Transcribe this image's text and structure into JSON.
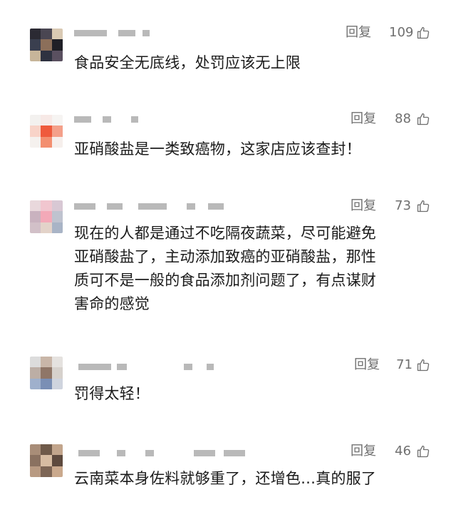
{
  "comments": [
    {
      "reply_label": "回复",
      "likes": "109",
      "text": "食品安全无底线，处罚应该无上限",
      "avatar_colors": [
        "#2b2a33",
        "#4a4652",
        "#d9c9b3",
        "#3a3f4f",
        "#8c6f5a",
        "#1f1f26",
        "#c7b59a",
        "#2e3240",
        "#5a5060"
      ]
    },
    {
      "reply_label": "回复",
      "likes": "88",
      "text": "亚硝酸盐是一类致癌物，这家店应该查封！",
      "avatar_colors": [
        "#f3f1ef",
        "#f7e9e6",
        "#f6f4f2",
        "#f8d3c8",
        "#ef5a3c",
        "#f4a08a",
        "#f5f1ee",
        "#f38f70",
        "#f6efec"
      ]
    },
    {
      "reply_label": "回复",
      "likes": "73",
      "text": "现在的人都是通过不吃隔夜蔬菜，尽可能避免\n亚硝酸盐了，主动添加致癌的亚硝酸盐，那性\n质可不是一般的食品添加剂问题了，有点谋财\n害命的感觉",
      "avatar_colors": [
        "#e9d8dc",
        "#f1c6cf",
        "#d8c8d4",
        "#c9b2bf",
        "#f3a9b8",
        "#bfc3cf",
        "#d2c0c8",
        "#e3d3c9",
        "#a9b4c6"
      ]
    },
    {
      "reply_label": "回复",
      "likes": "71",
      "text": "罚得太轻！",
      "avatar_colors": [
        "#dcdcdc",
        "#c9b6a8",
        "#e5e2df",
        "#bcaea5",
        "#8f7667",
        "#d6d1cc",
        "#9fb0cc",
        "#7a8fb5",
        "#cfd4de"
      ]
    },
    {
      "reply_label": "回复",
      "likes": "46",
      "text": "云南菜本身佐料就够重了，还增色…真的服了",
      "avatar_colors": [
        "#a88d78",
        "#6f5a4a",
        "#c2a58c",
        "#8a7160",
        "#d7bca2",
        "#5e4a3e",
        "#b89a82",
        "#7d6555",
        "#caa98d"
      ]
    }
  ]
}
